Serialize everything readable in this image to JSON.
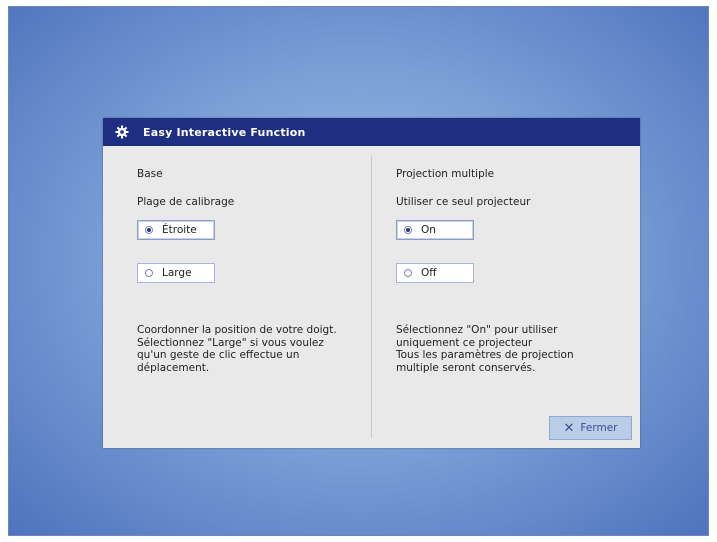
{
  "dialog": {
    "title": "Easy Interactive Function",
    "title_icon": "gear-icon",
    "close_label": "Fermer",
    "close_icon": "close-icon"
  },
  "left": {
    "section_title": "Base",
    "subtitle": "Plage de calibrage",
    "options": [
      {
        "label": "Étroite",
        "selected": true
      },
      {
        "label": "Large",
        "selected": false
      }
    ],
    "description": "Coordonner la position de votre doigt.\nSélectionnez \"Large\" si vous voulez\nqu'un geste de clic effectue un\ndéplacement."
  },
  "right": {
    "section_title": "Projection multiple",
    "subtitle": "Utiliser ce seul projecteur",
    "options": [
      {
        "label": "On",
        "selected": true
      },
      {
        "label": "Off",
        "selected": false
      }
    ],
    "description": "Sélectionnez \"On\" pour utiliser\nuniquement ce projecteur\nTous les paramètres de projection\nmultiple seront conservés."
  },
  "colors": {
    "titlebar": "#1f2e80",
    "accent": "#27348b",
    "close_button_bg": "#b9cde9"
  }
}
